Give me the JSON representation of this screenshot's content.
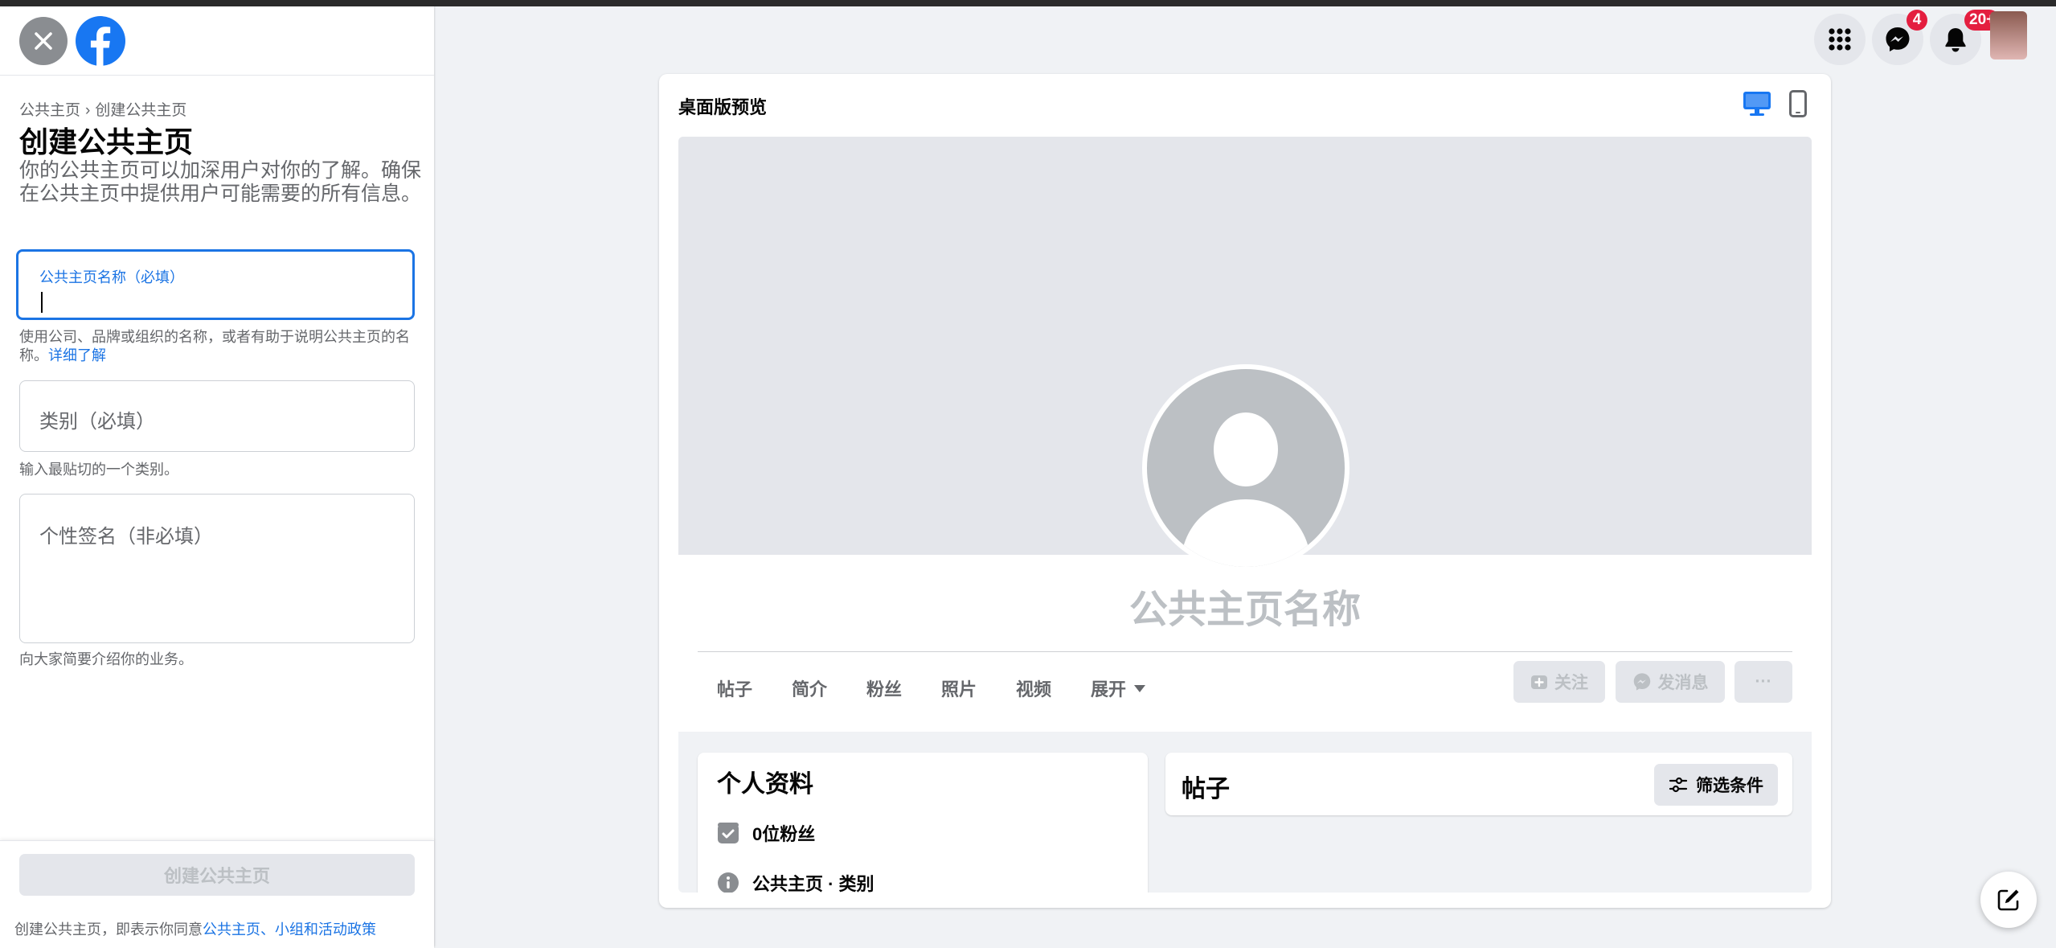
{
  "colors": {
    "accent": "#1b74e4",
    "badge": "#e41e3f",
    "muted": "#65676b",
    "disabled": "#bcc0c4"
  },
  "left_panel": {
    "close_icon": "close-icon",
    "logo": "facebook-logo",
    "breadcrumb": [
      "公共主页",
      "创建公共主页"
    ],
    "breadcrumb_sep": "›",
    "title": "创建公共主页",
    "description": "你的公共主页可以加深用户对你的了解。确保在公共主页中提供用户可能需要的所有信息。",
    "name_field": {
      "label": "公共主页名称（必填）",
      "value": ""
    },
    "name_help": "使用公司、品牌或组织的名称，或者有助于说明公共主页的名称。",
    "name_help_link": "详细了解",
    "category_field": {
      "placeholder": "类别（必填）"
    },
    "category_help": "输入最贴切的一个类别。",
    "bio_field": {
      "placeholder": "个性签名（非必填）"
    },
    "bio_help": "向大家简要介绍你的业务。",
    "create_button": "创建公共主页",
    "terms_prefix": "创建公共主页，即表示你同意",
    "terms_link": "公共主页、小组和活动政策"
  },
  "topbar": {
    "menu_icon": "menu-grid-icon",
    "messenger_badge": "4",
    "notifications_badge": "20+"
  },
  "preview": {
    "title": "桌面版预览",
    "desktop_icon": "desktop-icon",
    "mobile_icon": "mobile-icon",
    "page_name": "公共主页名称",
    "tabs": [
      "帖子",
      "简介",
      "粉丝",
      "照片",
      "视频",
      "展开"
    ],
    "follow_button": "关注",
    "message_button": "发消息",
    "more_button": "···",
    "intro_title": "个人资料",
    "followers": "0位粉丝",
    "category_line": "公共主页 · 类别",
    "posts_title": "帖子",
    "filter_button": "筛选条件"
  }
}
